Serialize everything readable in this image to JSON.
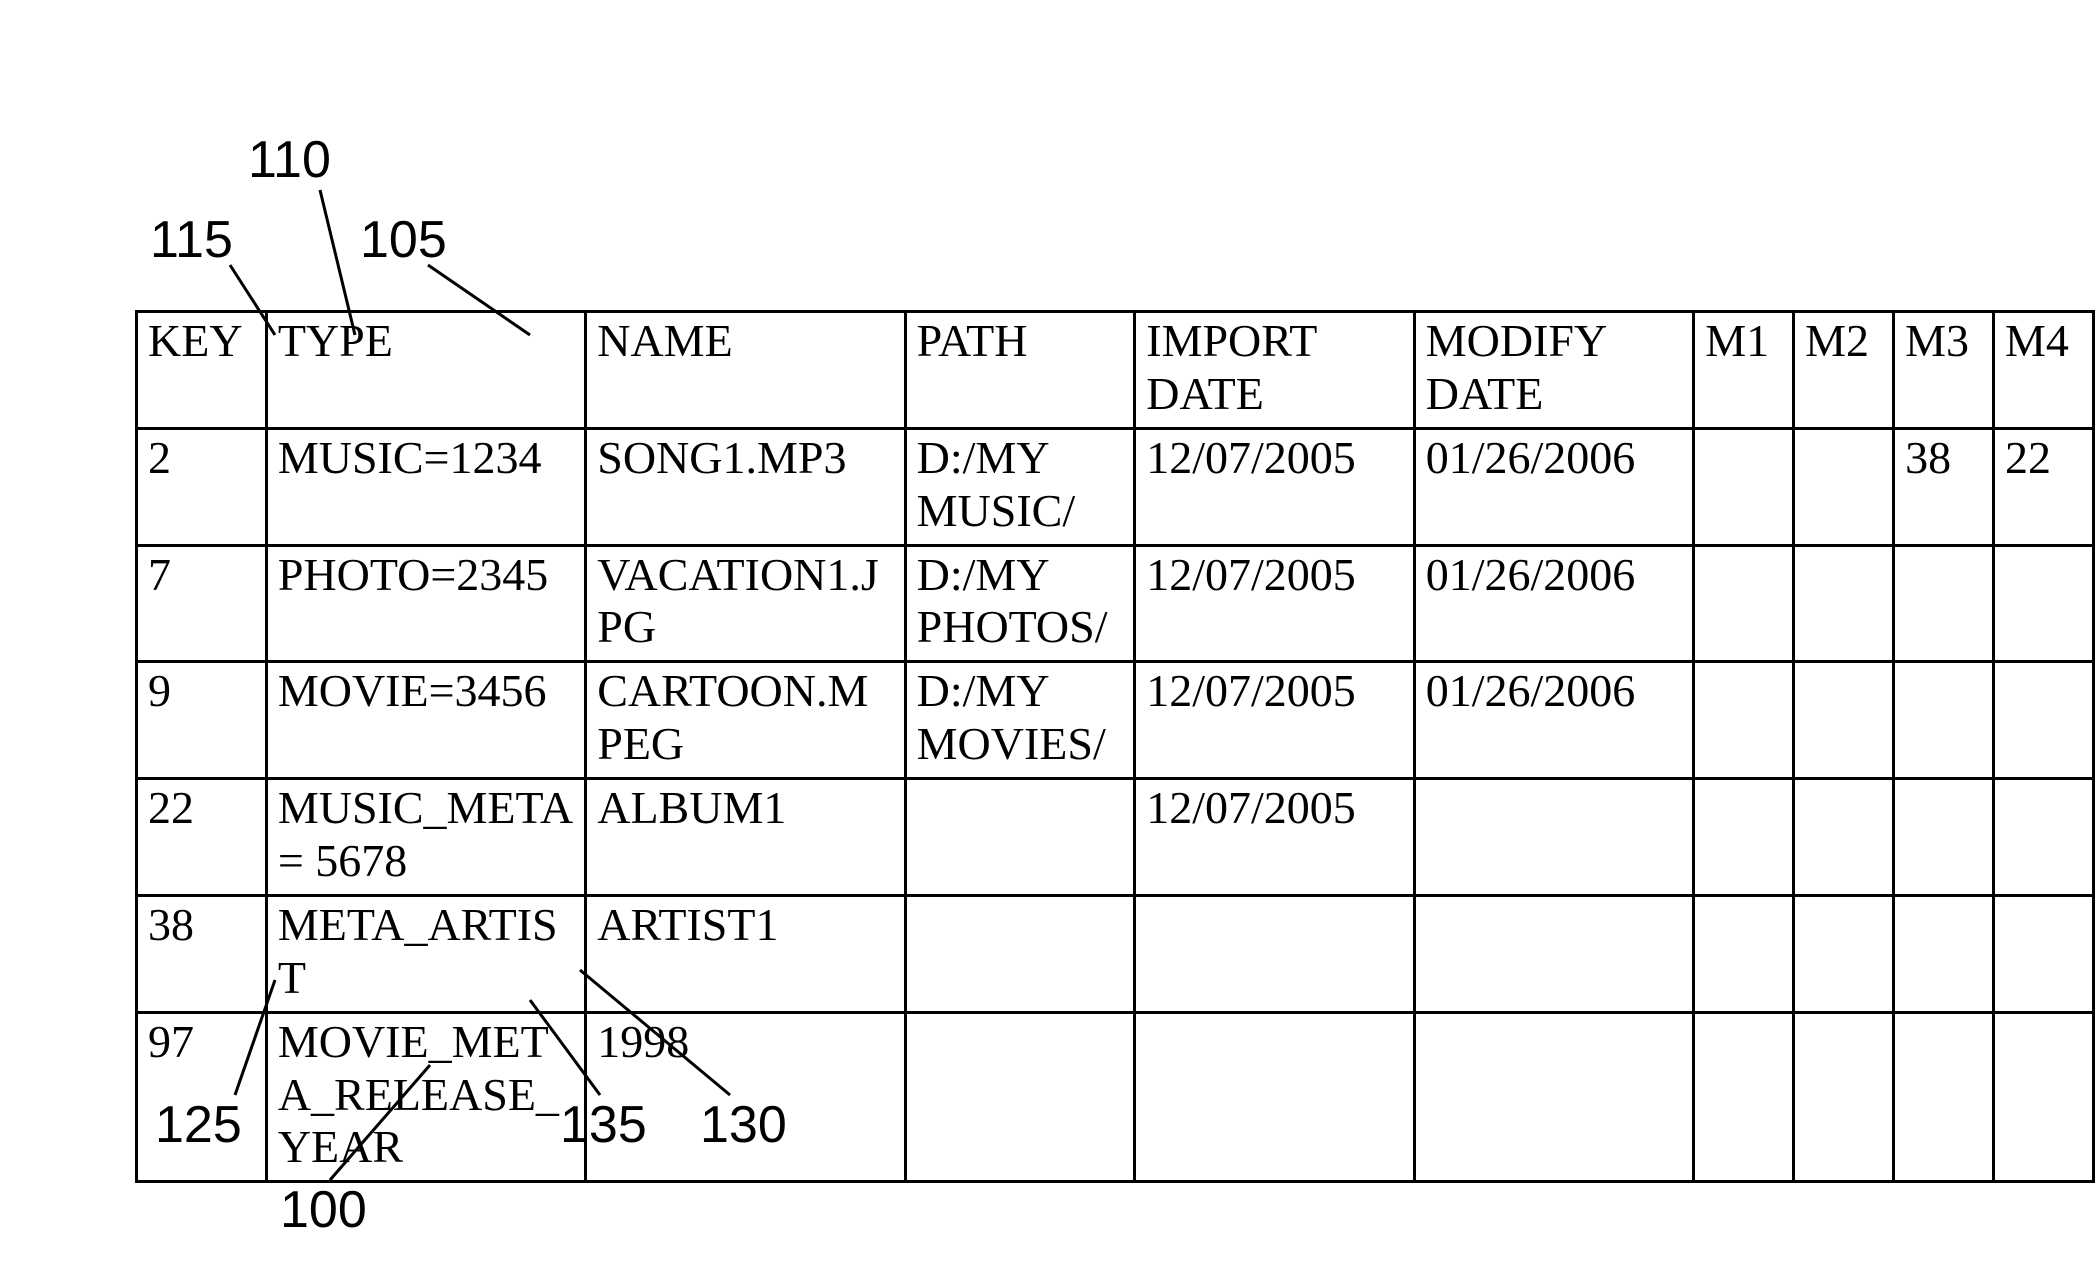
{
  "table": {
    "headers": [
      "KEY",
      "TYPE",
      "NAME",
      "PATH",
      "IMPORT DATE",
      "MODIFY DATE",
      "M1",
      "M2",
      "M3",
      "M4"
    ],
    "rows": [
      {
        "key": "2",
        "type": "MUSIC=1234",
        "name": "SONG1.MP3",
        "path": "D:/MY MUSIC/",
        "import_date": "12/07/2005",
        "modify_date": "01/26/2006",
        "m1": "",
        "m2": "",
        "m3": "38",
        "m4": "22"
      },
      {
        "key": "7",
        "type": "PHOTO=2345",
        "name": "VACATION1.JPG",
        "path": "D:/MY PHOTOS/",
        "import_date": "12/07/2005",
        "modify_date": "01/26/2006",
        "m1": "",
        "m2": "",
        "m3": "",
        "m4": ""
      },
      {
        "key": "9",
        "type": "MOVIE=3456",
        "name": "CARTOON.MPEG",
        "path": "D:/MY MOVIES/",
        "import_date": "12/07/2005",
        "modify_date": "01/26/2006",
        "m1": "",
        "m2": "",
        "m3": "",
        "m4": ""
      },
      {
        "key": "22",
        "type": "MUSIC_META = 5678",
        "name": "ALBUM1",
        "path": "",
        "import_date": "12/07/2005",
        "modify_date": "",
        "m1": "",
        "m2": "",
        "m3": "",
        "m4": ""
      },
      {
        "key": "38",
        "type": "META_ARTIST",
        "name": "ARTIST1",
        "path": "",
        "import_date": "",
        "modify_date": "",
        "m1": "",
        "m2": "",
        "m3": "",
        "m4": ""
      },
      {
        "key": "97",
        "type": "MOVIE_META_RELEASE_YEAR",
        "name": "1998",
        "path": "",
        "import_date": "",
        "modify_date": "",
        "m1": "",
        "m2": "",
        "m3": "",
        "m4": ""
      }
    ]
  },
  "callouts": {
    "c110": "110",
    "c115": "115",
    "c105": "105",
    "c125": "125",
    "c100": "100",
    "c135": "135",
    "c130": "130"
  }
}
